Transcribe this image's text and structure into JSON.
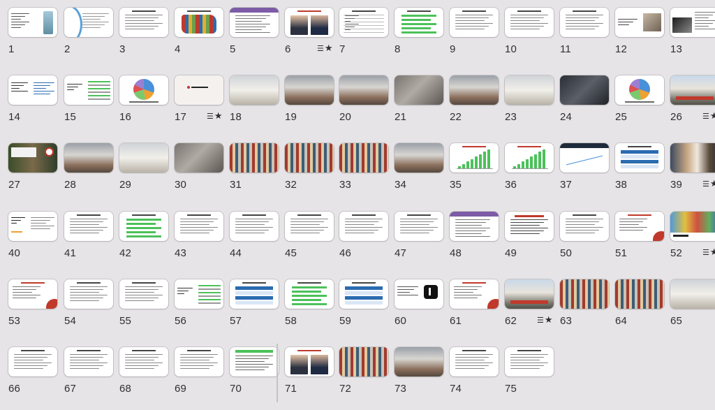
{
  "slides": [
    {
      "num": "1",
      "kind": "liberty",
      "starred": false
    },
    {
      "num": "2",
      "kind": "arc",
      "starred": false
    },
    {
      "num": "3",
      "kind": "text",
      "starred": false
    },
    {
      "num": "4",
      "kind": "usmap",
      "starred": false
    },
    {
      "num": "5",
      "kind": "purplehead",
      "starred": false
    },
    {
      "num": "6",
      "kind": "portraits",
      "starred": true
    },
    {
      "num": "7",
      "kind": "table",
      "starred": false
    },
    {
      "num": "8",
      "kind": "greenbars",
      "starred": false
    },
    {
      "num": "9",
      "kind": "text",
      "starred": false
    },
    {
      "num": "10",
      "kind": "text",
      "starred": false
    },
    {
      "num": "11",
      "kind": "text",
      "starred": false
    },
    {
      "num": "12",
      "kind": "textphoto",
      "starred": false
    },
    {
      "num": "13",
      "kind": "darkphoto",
      "starred": false
    },
    {
      "num": "14",
      "kind": "bluetext",
      "starred": false
    },
    {
      "num": "15",
      "kind": "greenlist",
      "starred": false
    },
    {
      "num": "16",
      "kind": "pie",
      "starred": false
    },
    {
      "num": "17",
      "kind": "macys",
      "starred": true
    },
    {
      "num": "18",
      "kind": "photo-light",
      "starred": false
    },
    {
      "num": "19",
      "kind": "photo-store",
      "starred": false
    },
    {
      "num": "20",
      "kind": "photo-store",
      "starred": false
    },
    {
      "num": "21",
      "kind": "photo-grey",
      "starred": false
    },
    {
      "num": "22",
      "kind": "photo-store",
      "starred": false
    },
    {
      "num": "23",
      "kind": "photo-light",
      "starred": false
    },
    {
      "num": "24",
      "kind": "photo-dark",
      "starred": false
    },
    {
      "num": "25",
      "kind": "pie",
      "starred": false
    },
    {
      "num": "26",
      "kind": "storefront",
      "starred": true
    },
    {
      "num": "27",
      "kind": "target",
      "starred": false
    },
    {
      "num": "28",
      "kind": "photo-store",
      "starred": false
    },
    {
      "num": "29",
      "kind": "photo-light",
      "starred": false
    },
    {
      "num": "30",
      "kind": "photo-grey",
      "starred": false
    },
    {
      "num": "31",
      "kind": "photo-shelf",
      "starred": false
    },
    {
      "num": "32",
      "kind": "photo-shelf",
      "starred": false
    },
    {
      "num": "33",
      "kind": "photo-shelf",
      "starred": false
    },
    {
      "num": "34",
      "kind": "photo-store",
      "starred": false
    },
    {
      "num": "35",
      "kind": "chartbars",
      "starred": false
    },
    {
      "num": "36",
      "kind": "chartbars",
      "starred": false
    },
    {
      "num": "37",
      "kind": "darkline",
      "starred": false
    },
    {
      "num": "38",
      "kind": "bluelist",
      "starred": false
    },
    {
      "num": "39",
      "kind": "people",
      "starred": true
    },
    {
      "num": "40",
      "kind": "amazon",
      "starred": false
    },
    {
      "num": "41",
      "kind": "text",
      "starred": false
    },
    {
      "num": "42",
      "kind": "greenbars",
      "starred": false
    },
    {
      "num": "43",
      "kind": "text",
      "starred": false
    },
    {
      "num": "44",
      "kind": "text",
      "starred": false
    },
    {
      "num": "45",
      "kind": "text",
      "starred": false
    },
    {
      "num": "46",
      "kind": "text",
      "starred": false
    },
    {
      "num": "47",
      "kind": "text",
      "starred": false
    },
    {
      "num": "48",
      "kind": "purplehead",
      "starred": false
    },
    {
      "num": "49",
      "kind": "redtitle",
      "starred": false
    },
    {
      "num": "50",
      "kind": "text",
      "starred": false
    },
    {
      "num": "51",
      "kind": "redcircle",
      "starred": false
    },
    {
      "num": "52",
      "kind": "roblox",
      "starred": true
    },
    {
      "num": "53",
      "kind": "redcircle",
      "starred": false
    },
    {
      "num": "54",
      "kind": "text",
      "starred": false
    },
    {
      "num": "55",
      "kind": "text",
      "starred": false
    },
    {
      "num": "56",
      "kind": "greenlist",
      "starred": false
    },
    {
      "num": "57",
      "kind": "bluelist",
      "starred": false
    },
    {
      "num": "58",
      "kind": "greenbars",
      "starred": false
    },
    {
      "num": "59",
      "kind": "bluelist",
      "starred": false
    },
    {
      "num": "60",
      "kind": "tiktok",
      "starred": false
    },
    {
      "num": "61",
      "kind": "redcircle",
      "starred": false
    },
    {
      "num": "62",
      "kind": "storefront",
      "starred": true
    },
    {
      "num": "63",
      "kind": "photo-shelf",
      "starred": false
    },
    {
      "num": "64",
      "kind": "photo-shelf",
      "starred": false
    },
    {
      "num": "65",
      "kind": "photo-light",
      "starred": false
    },
    {
      "num": "66",
      "kind": "text",
      "starred": false
    },
    {
      "num": "67",
      "kind": "text",
      "starred": false
    },
    {
      "num": "68",
      "kind": "text",
      "starred": false
    },
    {
      "num": "69",
      "kind": "text",
      "starred": false
    },
    {
      "num": "70",
      "kind": "greenhead",
      "starred": false
    },
    {
      "num": "71",
      "kind": "portraits",
      "starred": false
    },
    {
      "num": "72",
      "kind": "photo-shelf",
      "starred": false
    },
    {
      "num": "73",
      "kind": "photo-store",
      "starred": false
    },
    {
      "num": "74",
      "kind": "text",
      "starred": false
    },
    {
      "num": "75",
      "kind": "text",
      "starred": false
    }
  ],
  "colors": {
    "background": "#e6e4e6",
    "thumbnail": "#ffffff",
    "number_text": "#2f2f2f",
    "accent_red": "#c0392b",
    "accent_green": "#4cc15a",
    "accent_blue": "#2b6cb0",
    "accent_purple": "#7d5ba6"
  }
}
